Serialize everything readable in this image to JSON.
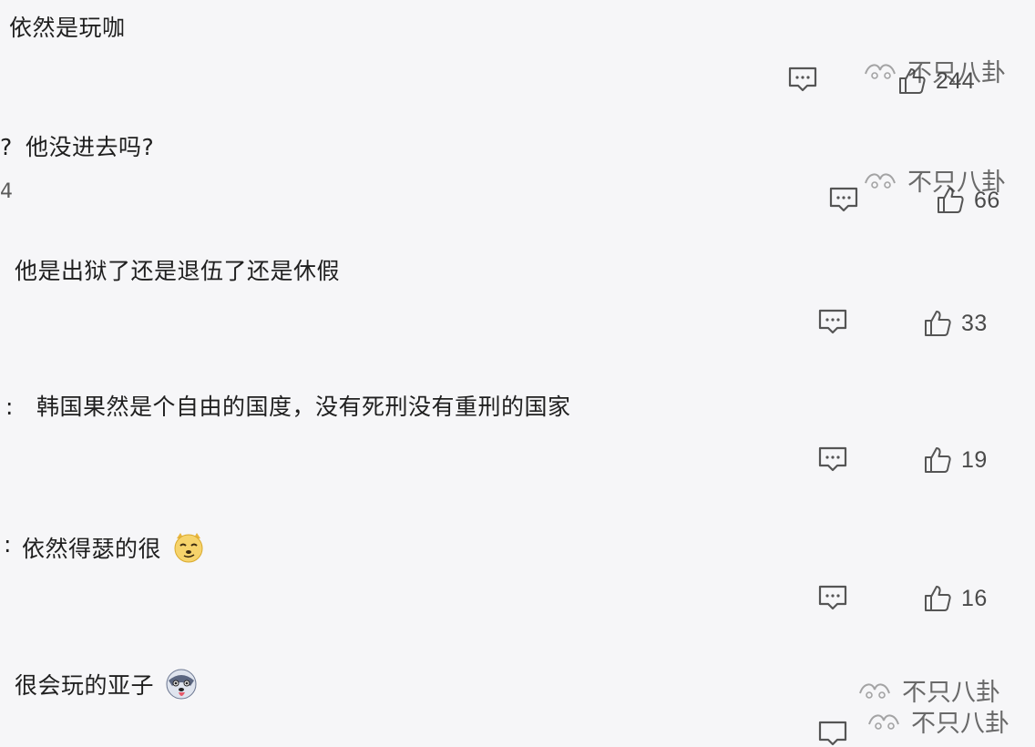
{
  "comments": [
    {
      "text": "依然是玩咖",
      "likes": "244"
    },
    {
      "prefix": "?",
      "text": "他没进去吗?",
      "likes": "66",
      "side": "4"
    },
    {
      "text": "他是出狱了还是退伍了还是休假",
      "likes": "33"
    },
    {
      "prefix": ":",
      "text": "韩国果然是个自由的国度，没有死刑没有重刑的国家",
      "likes": "19"
    },
    {
      "prefix": ":",
      "text": "依然得瑟的很",
      "likes": "16",
      "emoji": "smug-dog-emoji"
    },
    {
      "text": "很会玩的亚子",
      "emoji": "tongue-out-husky-emoji"
    }
  ],
  "watermark": {
    "text": "不只八卦"
  },
  "colors": {
    "background": "#f6f6f8",
    "icon": "#555555",
    "text": "#1f1f1f"
  }
}
